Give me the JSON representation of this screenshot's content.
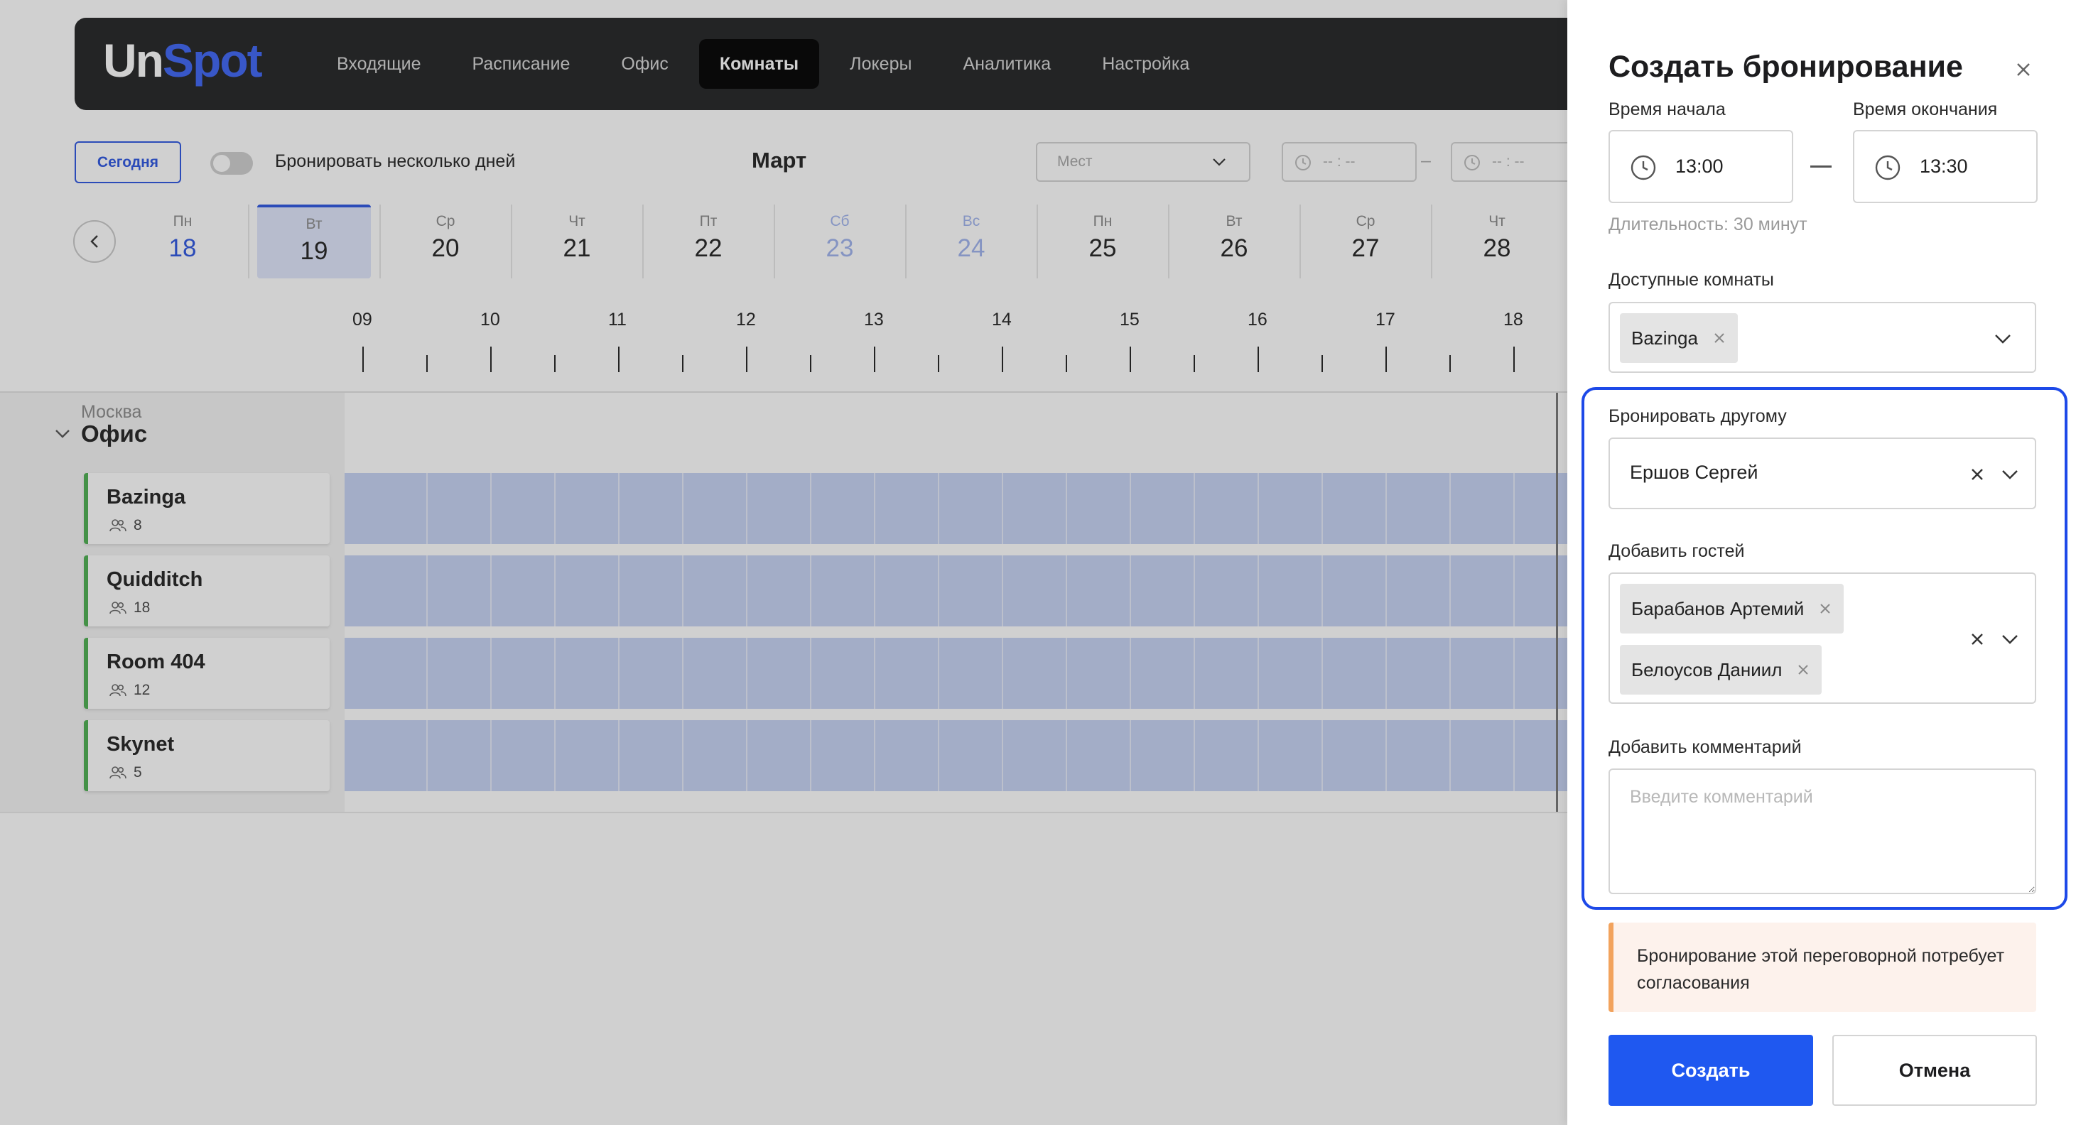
{
  "app": {
    "logo": {
      "part1": "Un",
      "part2": "Spot"
    },
    "nav": [
      "Входящие",
      "Расписание",
      "Офис",
      "Комнаты",
      "Локеры",
      "Аналитика",
      "Настройка"
    ],
    "active_nav": "Комнаты",
    "toolbar": {
      "today_label": "Сегодня",
      "multi_day_label": "Бронировать несколько дней",
      "multi_day_enabled": false,
      "month": "Март",
      "seats_placeholder": "Мест",
      "time_from_placeholder": "-- : --",
      "time_to_placeholder": "-- : --",
      "separator": "–"
    },
    "days": [
      {
        "wd": "Пн",
        "dn": "18",
        "state": "today"
      },
      {
        "wd": "Вт",
        "dn": "19",
        "state": "selected"
      },
      {
        "wd": "Ср",
        "dn": "20",
        "state": ""
      },
      {
        "wd": "Чт",
        "dn": "21",
        "state": ""
      },
      {
        "wd": "Пт",
        "dn": "22",
        "state": ""
      },
      {
        "wd": "Сб",
        "dn": "23",
        "state": "weekend"
      },
      {
        "wd": "Вс",
        "dn": "24",
        "state": "weekend"
      },
      {
        "wd": "Пн",
        "dn": "25",
        "state": ""
      },
      {
        "wd": "Вт",
        "dn": "26",
        "state": ""
      },
      {
        "wd": "Ср",
        "dn": "27",
        "state": ""
      },
      {
        "wd": "Чт",
        "dn": "28",
        "state": ""
      }
    ],
    "hours": [
      "09",
      "10",
      "11",
      "12",
      "13",
      "14",
      "15",
      "16",
      "17",
      "18"
    ],
    "location": {
      "city": "Москва",
      "office": "Офис"
    },
    "rooms": [
      {
        "name": "Bazinga",
        "capacity": "8"
      },
      {
        "name": "Quidditch",
        "capacity": "18"
      },
      {
        "name": "Room 404",
        "capacity": "12"
      },
      {
        "name": "Skynet",
        "capacity": "5"
      }
    ]
  },
  "drawer": {
    "title": "Создать бронирование",
    "start_label": "Время начала",
    "end_label": "Время окончания",
    "start_time": "13:00",
    "end_time": "13:30",
    "time_separator": "—",
    "duration": "Длительность: 30 минут",
    "rooms_label": "Доступные комнаты",
    "selected_room": "Bazinga",
    "book_for_label": "Бронировать другому",
    "book_for_value": "Ершов Сергей",
    "guests_label": "Добавить гостей",
    "guests": [
      "Барабанов Артемий",
      "Белоусов Даниил"
    ],
    "comment_label": "Добавить комментарий",
    "comment_placeholder": "Введите комментарий",
    "notice": "Бронирование этой переговорной потребует согласования",
    "create_label": "Создать",
    "cancel_label": "Отмена"
  },
  "colors": {
    "accent": "#1f58f0",
    "highlight": "#1d49e8",
    "room_slot": "#c6d2f4",
    "room_status": "#4caf50",
    "notice_bar": "#f2a35d",
    "header_bg": "#222325"
  }
}
